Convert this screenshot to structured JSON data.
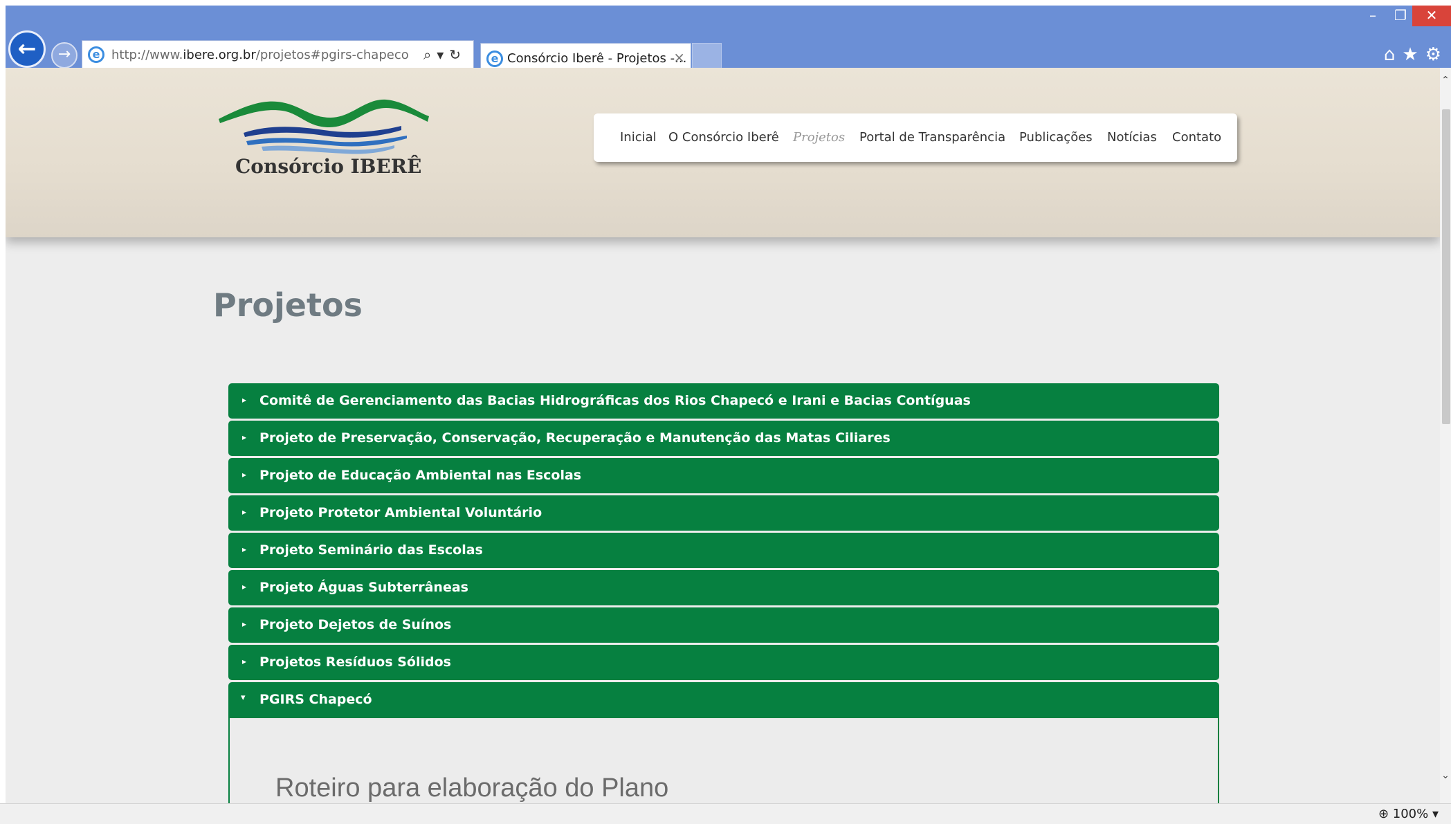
{
  "browser": {
    "window_controls": {
      "minimize": "–",
      "restore": "❐",
      "close": "✕"
    },
    "back_icon": "arrow-left-icon",
    "forward_icon": "arrow-right-icon",
    "address": {
      "url_prefix": "http://www.",
      "url_domain": "ibere.org.br",
      "url_path": "/projetos#pgirs-chapeco",
      "controls": "⌕▾↻"
    },
    "tab": {
      "title": "Consórcio Iberê - Projetos -...",
      "close": "×"
    },
    "toolbar_icons": "⌂★⚙",
    "zoom": "100%"
  },
  "site": {
    "logo_text": "Consórcio IBERÊ",
    "colors": {
      "accent_green": "#068040",
      "title_gray": "#6f7b82"
    },
    "menu": [
      {
        "label": "Inicial",
        "active": false
      },
      {
        "label": "O Consórcio Iberê",
        "active": false
      },
      {
        "label": "Projetos",
        "active": true
      },
      {
        "label": "Portal de Transparência",
        "active": false
      },
      {
        "label": "Publicações",
        "active": false
      },
      {
        "label": "Notícias",
        "active": false
      },
      {
        "label": "Contato",
        "active": false
      }
    ],
    "page_title": "Projetos",
    "accordion": {
      "items": [
        "Comitê de Gerenciamento das Bacias Hidrográficas dos Rios Chapecó e Irani e Bacias Contíguas",
        "Projeto de Preservação, Conservação, Recuperação e Manutenção das Matas Ciliares",
        "Projeto de Educação Ambiental nas Escolas",
        "Projeto Protetor Ambiental Voluntário",
        "Projeto Seminário das Escolas",
        "Projeto Águas Subterrâneas",
        "Projeto Dejetos de Suínos",
        "Projetos Resíduos Sólidos"
      ],
      "open_item": "PGIRS Chapecó",
      "open_content_title": "Roteiro para elaboração do Plano",
      "arrow_closed": "▸",
      "arrow_open": "▾"
    }
  }
}
